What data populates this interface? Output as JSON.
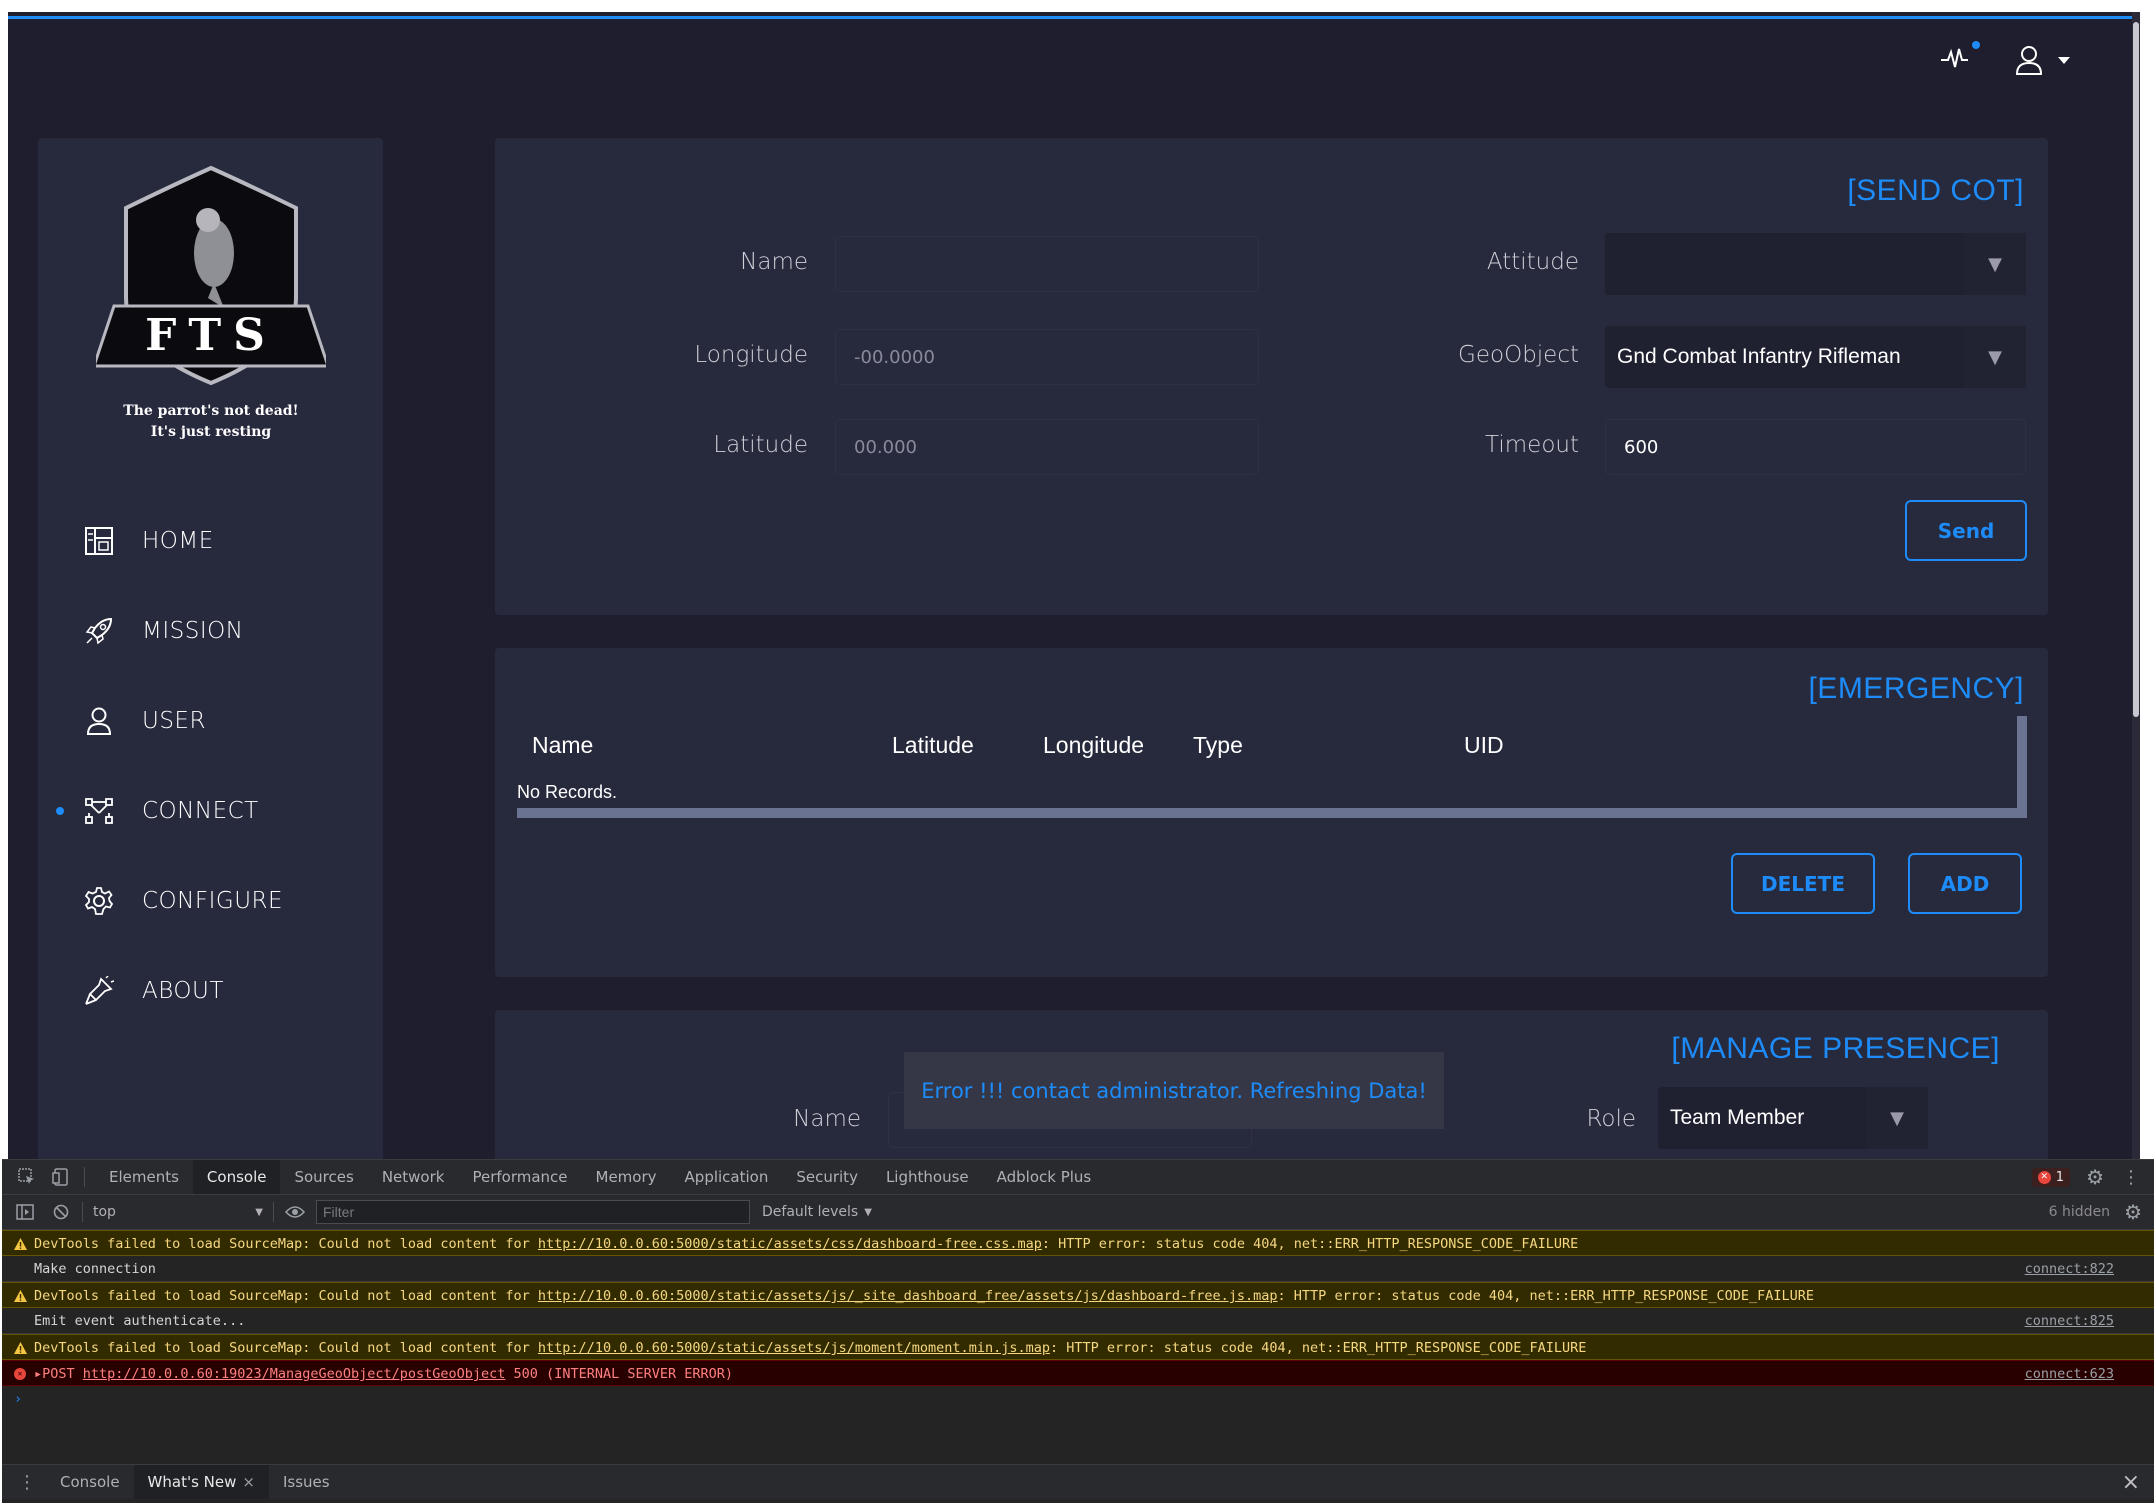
{
  "app": {
    "accent_color": "#1d8cf8",
    "background_color": "#1e1e2e",
    "card_color": "#27293d"
  },
  "navbar": {
    "activity_icon": "activity-pulse-icon",
    "user_icon": "user-icon"
  },
  "sidebar": {
    "logo_text": "FTS",
    "tagline_line1": "The parrot's not dead!",
    "tagline_line2": "It's just resting",
    "items": [
      {
        "label": "HOME",
        "icon": "dashboard-icon",
        "active": false
      },
      {
        "label": "MISSION",
        "icon": "rocket-icon",
        "active": false
      },
      {
        "label": "USER",
        "icon": "user-icon",
        "active": false
      },
      {
        "label": "CONNECT",
        "icon": "connect-icon",
        "active": true
      },
      {
        "label": "CONFIGURE",
        "icon": "gear-icon",
        "active": false
      },
      {
        "label": "ABOUT",
        "icon": "flashlight-icon",
        "active": false
      }
    ]
  },
  "send_cot": {
    "title": "[SEND COT]",
    "name_label": "Name",
    "name_value": "",
    "longitude_label": "Longitude",
    "longitude_placeholder": "-00.0000",
    "latitude_label": "Latitude",
    "latitude_placeholder": "00.000",
    "attitude_label": "Attitude",
    "attitude_value": "",
    "geoobject_label": "GeoObject",
    "geoobject_value": "Gnd Combat Infantry Rifleman",
    "timeout_label": "Timeout",
    "timeout_value": "600",
    "send_label": "Send"
  },
  "emergency": {
    "title": "[EMERGENCY]",
    "columns": [
      "Name",
      "Latitude",
      "Longitude",
      "Type",
      "UID"
    ],
    "empty_text": "No Records.",
    "delete_label": "DELETE",
    "add_label": "ADD"
  },
  "manage_presence": {
    "title": "[MANAGE PRESENCE]",
    "name_label": "Name",
    "role_label": "Role",
    "role_value": "Team Member"
  },
  "toast": {
    "message": "Error !!! contact administrator. Refreshing Data!"
  },
  "devtools": {
    "tabs": [
      "Elements",
      "Console",
      "Sources",
      "Network",
      "Performance",
      "Memory",
      "Application",
      "Security",
      "Lighthouse",
      "Adblock Plus"
    ],
    "active_tab": "Console",
    "error_count": "1",
    "context": "top",
    "filter_placeholder": "Filter",
    "levels": "Default levels",
    "hidden": "6 hidden",
    "lines": [
      {
        "level": "warn",
        "prefix": "DevTools failed to load SourceMap: Could not load content for ",
        "url": "http://10.0.0.60:5000/static/assets/css/dashboard-free.css.map",
        "suffix": ": HTTP error: status code 404, net::ERR_HTTP_RESPONSE_CODE_FAILURE",
        "source": ""
      },
      {
        "level": "log",
        "prefix": "Make connection",
        "url": "",
        "suffix": "",
        "source": "connect:822"
      },
      {
        "level": "warn",
        "prefix": "DevTools failed to load SourceMap: Could not load content for ",
        "url": "http://10.0.0.60:5000/static/assets/js/_site_dashboard_free/assets/js/dashboard-free.js.map",
        "suffix": ": HTTP error: status code 404, net::ERR_HTTP_RESPONSE_CODE_FAILURE",
        "source": ""
      },
      {
        "level": "log",
        "prefix": "Emit event authenticate...",
        "url": "",
        "suffix": "",
        "source": "connect:825"
      },
      {
        "level": "warn",
        "prefix": "DevTools failed to load SourceMap: Could not load content for ",
        "url": "http://10.0.0.60:5000/static/assets/js/moment/moment.min.js.map",
        "suffix": ": HTTP error: status code 404, net::ERR_HTTP_RESPONSE_CODE_FAILURE",
        "source": ""
      },
      {
        "level": "err",
        "prefix": "▸POST ",
        "url": "http://10.0.0.60:19023/ManageGeoObject/postGeoObject",
        "suffix": " 500 (INTERNAL SERVER ERROR)",
        "source": "connect:623"
      }
    ],
    "drawer_tabs": [
      "Console",
      "What's New",
      "Issues"
    ],
    "active_drawer_tab": "What's New"
  }
}
